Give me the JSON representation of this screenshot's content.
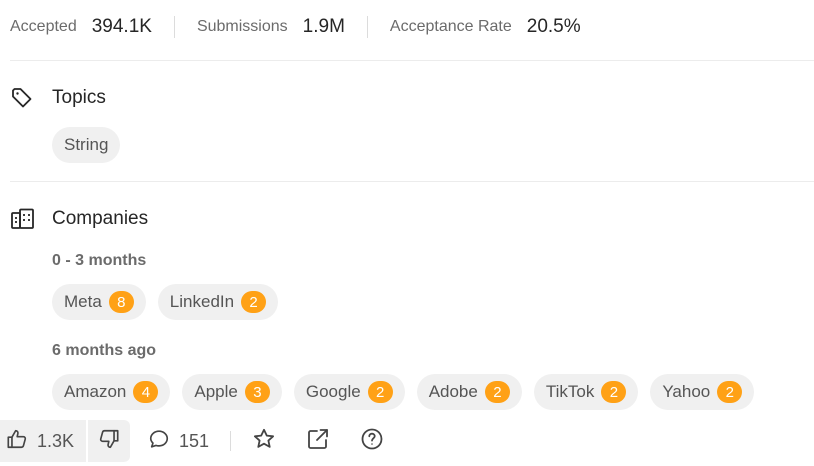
{
  "stats": [
    {
      "label": "Accepted",
      "value": "394.1K"
    },
    {
      "label": "Submissions",
      "value": "1.9M"
    },
    {
      "label": "Acceptance Rate",
      "value": "20.5%"
    }
  ],
  "topics": {
    "title": "Topics",
    "icon": "tag-icon",
    "items": [
      "String"
    ]
  },
  "companies": {
    "title": "Companies",
    "icon": "building-icon",
    "groups": [
      {
        "period": "0 - 3 months",
        "items": [
          {
            "name": "Meta",
            "count": "8"
          },
          {
            "name": "LinkedIn",
            "count": "2"
          }
        ]
      },
      {
        "period": "6 months ago",
        "items": [
          {
            "name": "Amazon",
            "count": "4"
          },
          {
            "name": "Apple",
            "count": "3"
          },
          {
            "name": "Google",
            "count": "2"
          },
          {
            "name": "Adobe",
            "count": "2"
          },
          {
            "name": "TikTok",
            "count": "2"
          },
          {
            "name": "Yahoo",
            "count": "2"
          }
        ]
      }
    ]
  },
  "actions": {
    "likes": "1.3K",
    "comments": "151"
  },
  "colors": {
    "badge": "#ffa116",
    "chip": "#f0f0f0"
  }
}
